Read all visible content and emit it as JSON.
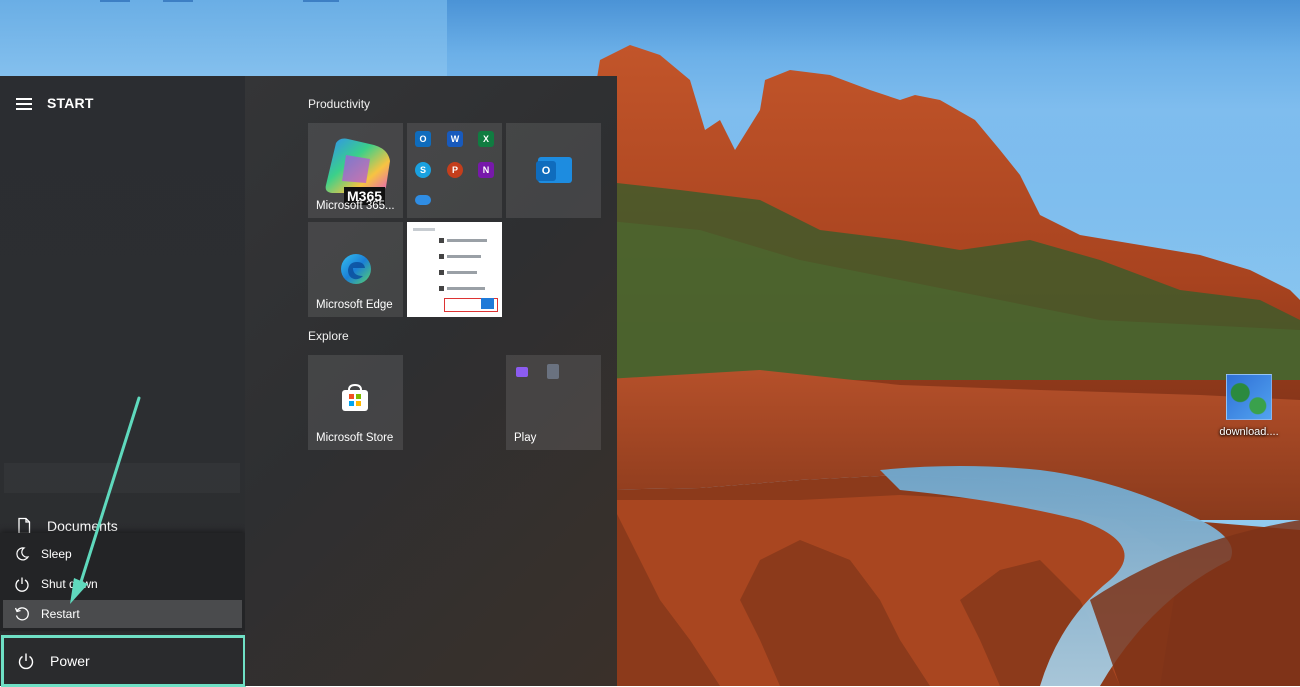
{
  "desktop": {
    "icon_label": "download...."
  },
  "start_menu": {
    "title": "START",
    "left_items": [
      {
        "label": "Documents",
        "icon": "document-icon"
      }
    ],
    "power_menu": {
      "items": [
        {
          "label": "Sleep",
          "icon": "moon-icon"
        },
        {
          "label": "Shut down",
          "icon": "power-icon"
        },
        {
          "label": "Restart",
          "icon": "restart-icon",
          "highlighted": true
        }
      ]
    },
    "power_button": {
      "label": "Power",
      "icon": "power-icon"
    },
    "groups": [
      {
        "label": "Productivity",
        "tiles": [
          {
            "name": "Microsoft 365...",
            "badge": "M365",
            "icon": "m365-icon"
          },
          {
            "name": "",
            "icon": "office-apps-folder-icon",
            "apps": [
              "O",
              "W",
              "X",
              "S",
              "P",
              "N"
            ]
          },
          {
            "name": "",
            "icon": "outlook-icon",
            "letter": "O"
          },
          {
            "name": "Microsoft Edge",
            "icon": "edge-icon"
          },
          {
            "name": "",
            "icon": "screenshot-preview-icon"
          }
        ]
      },
      {
        "label": "Explore",
        "tiles": [
          {
            "name": "Microsoft Store",
            "icon": "store-icon"
          },
          {
            "name": "Play",
            "icon": "play-folder-icon"
          }
        ]
      }
    ]
  },
  "colors": {
    "highlight_border": "#6fe0c5",
    "arrow": "#5fd9bd",
    "menu_bg": "#2b2d31"
  }
}
